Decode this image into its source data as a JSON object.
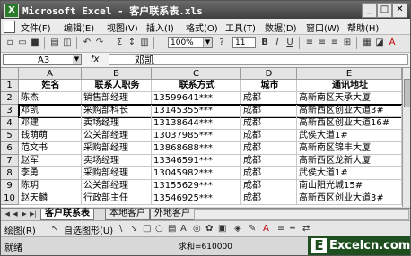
{
  "window": {
    "title": "Microsoft Excel - 客户联系表.xls"
  },
  "icons": {
    "app": "excel-icon",
    "minimize": "minimize-icon",
    "maximize": "maximize-icon",
    "close": "close-icon"
  },
  "menu": {
    "items": [
      "文件(F)",
      "编辑(E)",
      "视图(V)",
      "插入(I)",
      "格式(O)",
      "工具(T)",
      "数据(D)",
      "窗口(W)",
      "帮助(H)"
    ]
  },
  "toolbar": {
    "zoom": "100%",
    "font_size": "11",
    "sigma": "Σ"
  },
  "formula_bar": {
    "name_box": "A3",
    "fx": "fx",
    "content": "邓凯"
  },
  "columns": [
    "A",
    "B",
    "C",
    "D",
    "E"
  ],
  "rows": [
    {
      "num": "1",
      "cells": [
        "姓名",
        "联系人职务",
        "联系方式",
        "城市",
        "通讯地址"
      ]
    },
    {
      "num": "2",
      "cells": [
        "陈杰",
        "销售部经理",
        "13599641***",
        "成都",
        "高新南区天承大厦"
      ]
    },
    {
      "num": "3",
      "cells": [
        "邓凯",
        "采购部科长",
        "13145355***",
        "成都",
        "高新西区创业大道3#"
      ]
    },
    {
      "num": "4",
      "cells": [
        "邓建",
        "卖场经理",
        "13138644***",
        "成都",
        "高新西区创业大道16#"
      ]
    },
    {
      "num": "5",
      "cells": [
        "钱萌萌",
        "公关部经理",
        "13037985***",
        "成都",
        "武侯大道1#"
      ]
    },
    {
      "num": "6",
      "cells": [
        "范文书",
        "采购部经理",
        "13868688***",
        "成都",
        "高新南区锦丰大厦"
      ]
    },
    {
      "num": "7",
      "cells": [
        "赵军",
        "卖场经理",
        "13346591***",
        "成都",
        "高新西区龙新大厦"
      ]
    },
    {
      "num": "8",
      "cells": [
        "李勇",
        "采购部经理",
        "13045982***",
        "成都",
        "武侯大道1#"
      ]
    },
    {
      "num": "9",
      "cells": [
        "陈玥",
        "公关部经理",
        "13155629***",
        "成都",
        "南山阳光城15#"
      ]
    },
    {
      "num": "10",
      "cells": [
        "赵天麟",
        "行政部主任",
        "13546925***",
        "成都",
        "高新西区创业大道3#"
      ]
    }
  ],
  "sheet_tabs": [
    "客户联系表",
    "本地客户",
    "外地客户"
  ],
  "active_sheet": "客户联系表",
  "draw_toolbar": {
    "draw": "绘图(R)",
    "autoshapes": "自选图形(U)"
  },
  "status": {
    "ready": "就绪",
    "sum": "求和=610000"
  },
  "watermark": {
    "letter": "E",
    "text": "Excelcn.com"
  }
}
